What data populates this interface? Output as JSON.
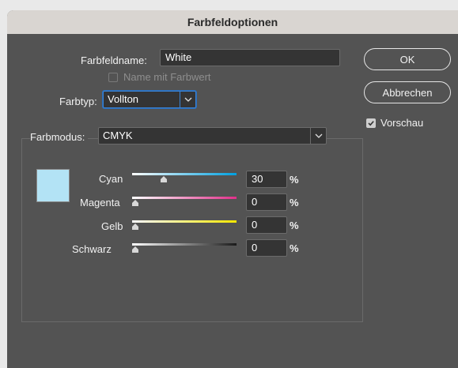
{
  "dialog": {
    "title": "Farbfeldoptionen",
    "name_label": "Farbfeldname:",
    "name_value": "White",
    "name_with_value_label": "Name mit Farbwert",
    "name_with_value_checked": false,
    "type_label": "Farbtyp:",
    "type_value": "Vollton",
    "mode_label": "Farbmodus:",
    "mode_value": "CMYK",
    "ok_label": "OK",
    "cancel_label": "Abbrechen",
    "preview_label": "Vorschau",
    "preview_checked": true
  },
  "swatch": {
    "color": "#b3e3f5"
  },
  "sliders": [
    {
      "label": "Cyan",
      "value": "30",
      "unit": "%",
      "fraction": 0.3,
      "gradient": [
        "#ffffff",
        "#00a0e0"
      ]
    },
    {
      "label": "Magenta",
      "value": "0",
      "unit": "%",
      "fraction": 0.0,
      "gradient": [
        "#ffffff",
        "#e0308a"
      ]
    },
    {
      "label": "Gelb",
      "value": "0",
      "unit": "%",
      "fraction": 0.0,
      "gradient": [
        "#ffffff",
        "#f5e600"
      ]
    },
    {
      "label": "Schwarz",
      "value": "0",
      "unit": "%",
      "fraction": 0.0,
      "gradient": [
        "#ffffff",
        "#1a1a1a"
      ]
    }
  ]
}
